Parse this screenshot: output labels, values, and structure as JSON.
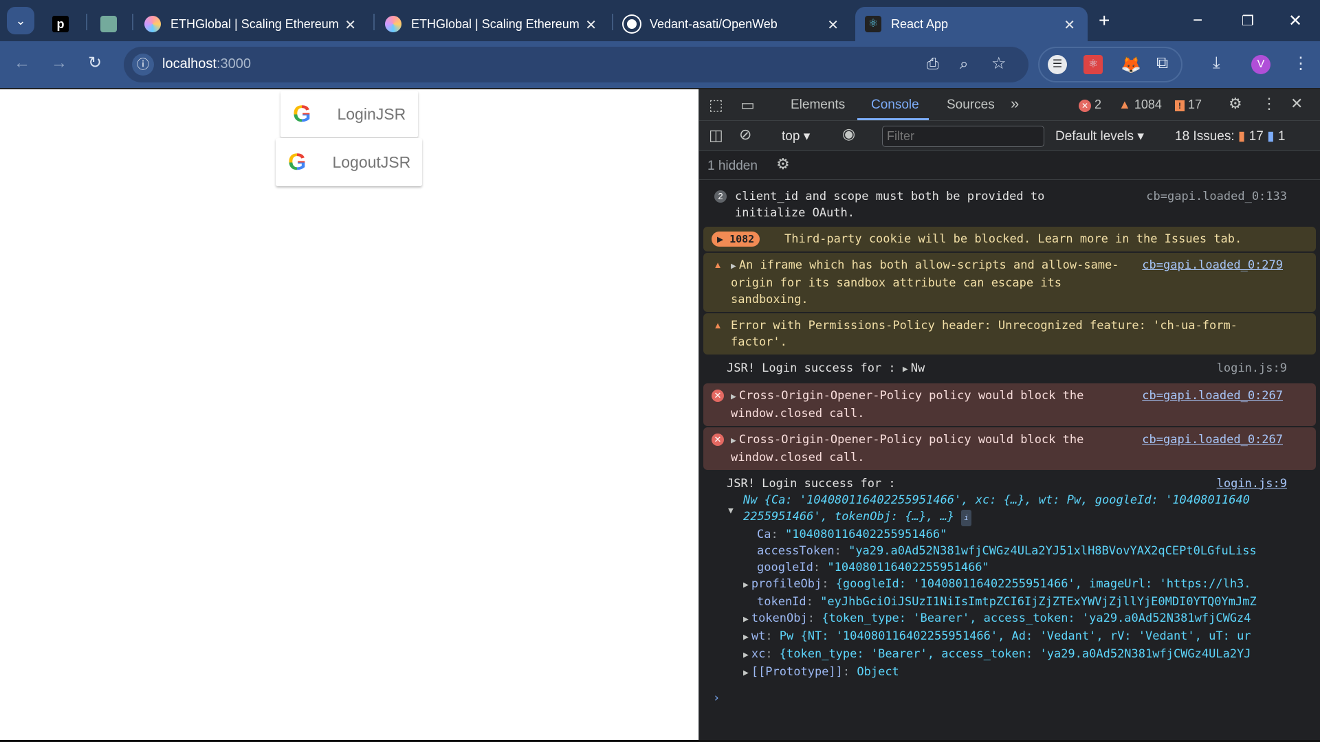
{
  "browser": {
    "tabs": [
      {
        "title": "",
        "favicon": "p-icon"
      },
      {
        "title": "",
        "favicon": "chatgpt-icon"
      },
      {
        "title": "ETHGlobal | Scaling Ethereum",
        "favicon": "ethglobal-icon"
      },
      {
        "title": "ETHGlobal | Scaling Ethereum",
        "favicon": "ethglobal-icon"
      },
      {
        "title": "Vedant-asati/OpenWeb",
        "favicon": "github-icon"
      },
      {
        "title": "React App",
        "favicon": "react-icon",
        "active": true
      }
    ],
    "url_host": "localhost",
    "url_port": ":3000",
    "profile_initial": "V"
  },
  "page": {
    "login_label": "LoginJSR",
    "logout_label": "LogoutJSR"
  },
  "devtools": {
    "tabs": [
      "Elements",
      "Console",
      "Sources"
    ],
    "active_tab": "Console",
    "error_count": "2",
    "warning_count": "1084",
    "issue_count": "17",
    "context": "top",
    "filter_placeholder": "Filter",
    "levels": "Default levels",
    "issues_label": "18 Issues:",
    "issues_warn": "17",
    "issues_info": "1",
    "hidden": "1 hidden",
    "messages": {
      "m1": {
        "count": "2",
        "text": "client_id and scope must both be provided to initialize OAuth.",
        "source": "cb=gapi.loaded_0:133"
      },
      "m2": {
        "count": "1082",
        "text": "Third-party cookie will be blocked. Learn more in the Issues tab."
      },
      "m3": {
        "text": "An iframe which has both allow-scripts and allow-same-origin for its sandbox attribute can escape its sandboxing.",
        "source": "cb=gapi.loaded_0:279"
      },
      "m4": {
        "text": "Error with Permissions-Policy header: Unrecognized feature: 'ch-ua-form-factor'."
      },
      "m5": {
        "text": "JSR! Login success for : ",
        "obj": "Nw",
        "source": "login.js:9"
      },
      "m6": {
        "text": "Cross-Origin-Opener-Policy policy would block the window.closed call.",
        "source": "cb=gapi.loaded_0:267"
      },
      "m7": {
        "text": "Cross-Origin-Opener-Policy policy would block the window.closed call.",
        "source": "cb=gapi.loaded_0:267"
      },
      "m8": {
        "text": "JSR! Login success for :",
        "source": "login.js:9"
      }
    },
    "object": {
      "summary_1": "Nw {Ca: '104080116402255951466', xc: {…}, wt: Pw, googleId: '10408011640",
      "summary_2": "2255951466', tokenObj: {…}, …}",
      "props": [
        {
          "key": "Ca",
          "value": "\"104080116402255951466\"",
          "expandable": false
        },
        {
          "key": "accessToken",
          "value": "\"ya29.a0Ad52N381wfjCWGz4ULa2YJ51xlH8BVovYAX2qCEPt0LGfuLiss",
          "expandable": false
        },
        {
          "key": "googleId",
          "value": "\"104080116402255951466\"",
          "expandable": false
        },
        {
          "key": "profileObj",
          "value": "{googleId: '104080116402255951466', imageUrl: 'https://lh3.",
          "expandable": true
        },
        {
          "key": "tokenId",
          "value": "\"eyJhbGciOiJSUzI1NiIsImtpZCI6IjZjZTExYWVjZjllYjE0MDI0YTQ0YmJmZ",
          "expandable": false
        },
        {
          "key": "tokenObj",
          "value": "{token_type: 'Bearer', access_token: 'ya29.a0Ad52N381wfjCWGz4",
          "expandable": true
        },
        {
          "key": "wt",
          "value": "Pw {NT: '104080116402255951466', Ad: 'Vedant', rV: 'Vedant', uT: ur",
          "expandable": true
        },
        {
          "key": "xc",
          "value": "{token_type: 'Bearer', access_token: 'ya29.a0Ad52N381wfjCWGz4ULa2YJ",
          "expandable": true
        },
        {
          "key": "[[Prototype]]",
          "value": "Object",
          "expandable": true
        }
      ]
    },
    "prompt": "›"
  }
}
